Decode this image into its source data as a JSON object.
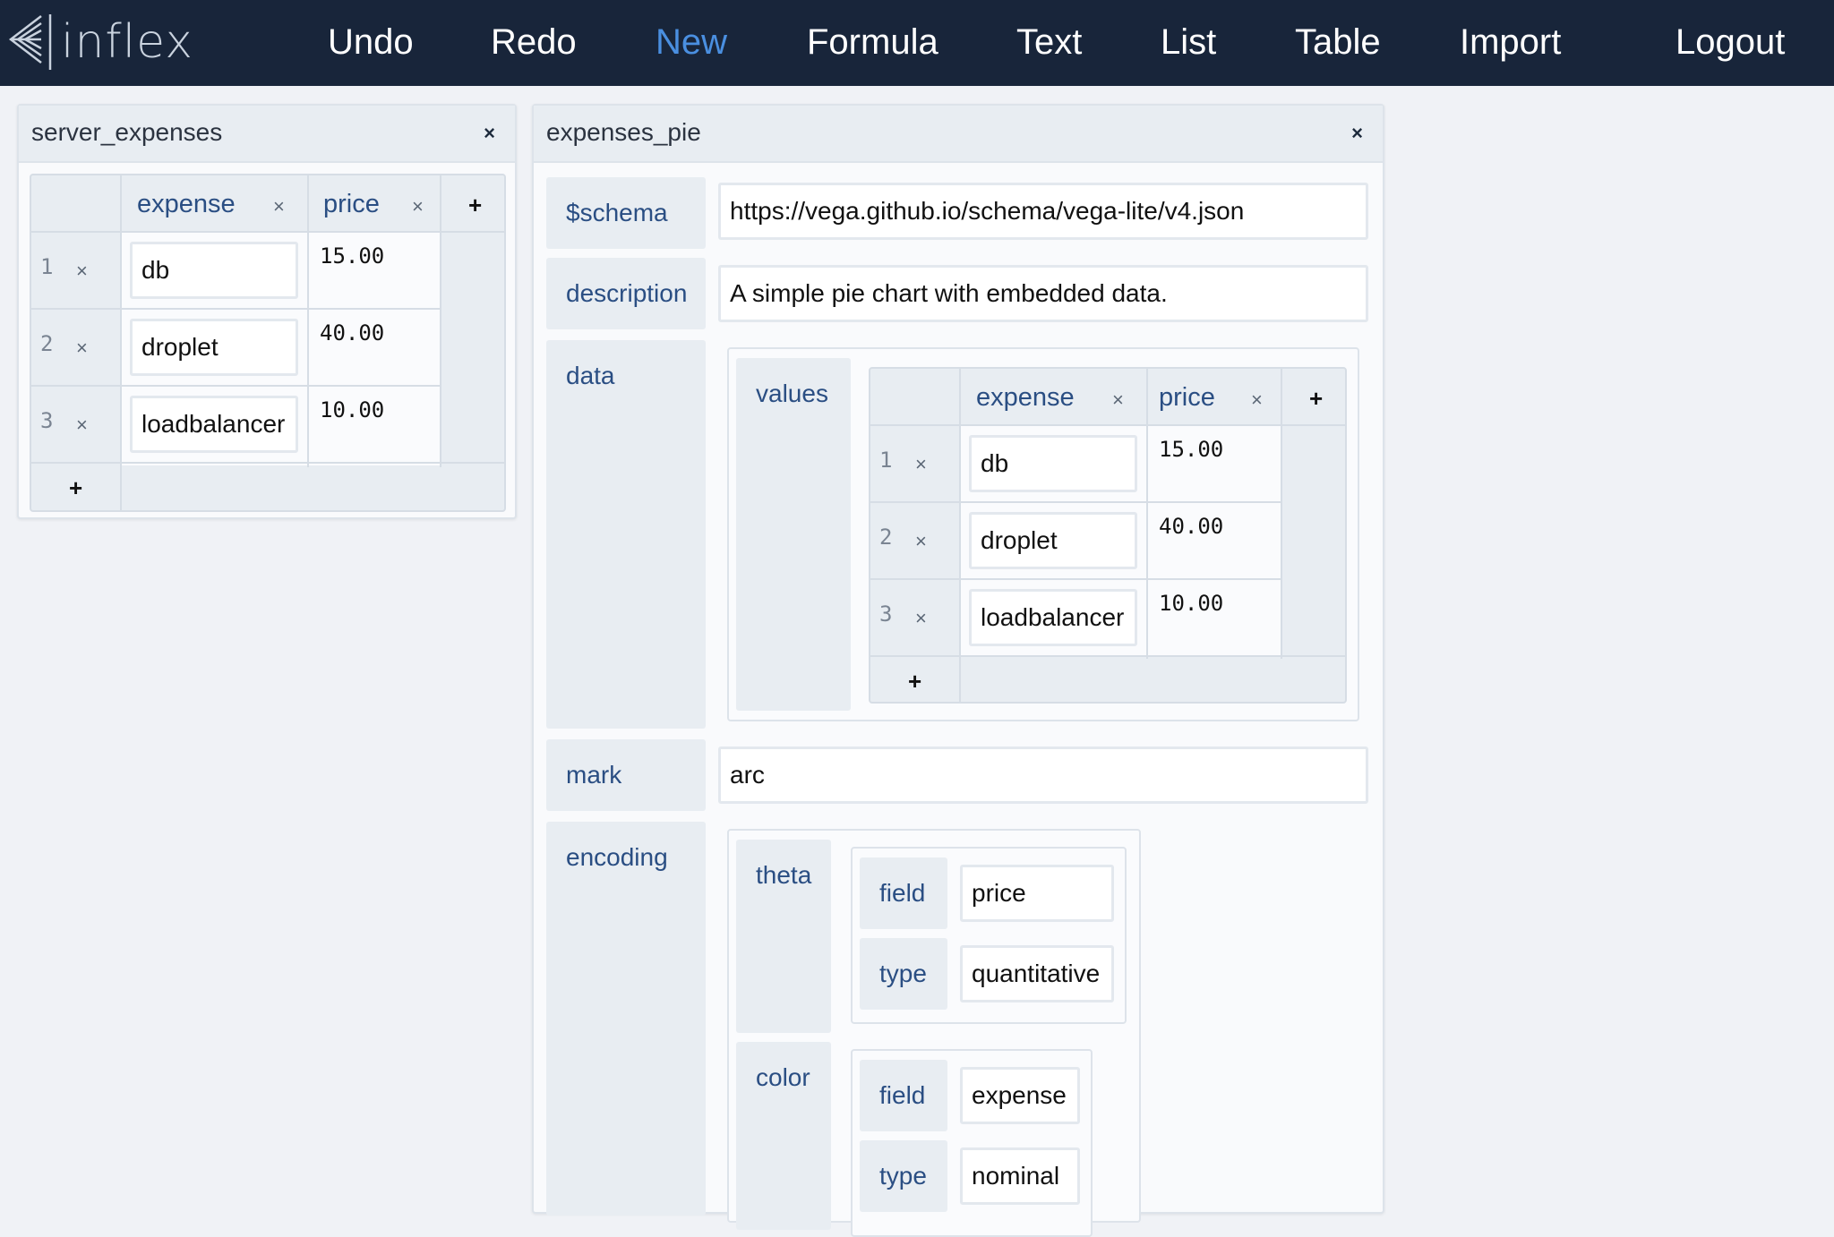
{
  "app": {
    "logo_text": "inflex"
  },
  "nav": {
    "undo": "Undo",
    "redo": "Redo",
    "new": "New",
    "formula": "Formula",
    "text": "Text",
    "list": "List",
    "table": "Table",
    "import": "Import",
    "logout": "Logout"
  },
  "colors": {
    "nav_bg": "#18253a",
    "active_nav": "#4a8fe0",
    "key_text": "#2a4e83"
  },
  "server_expenses": {
    "title": "server_expenses",
    "close": "×",
    "columns": [
      {
        "name": "expense",
        "remove": "×"
      },
      {
        "name": "price",
        "remove": "×"
      }
    ],
    "add_column": "+",
    "add_row": "+",
    "rows": [
      {
        "num": "1",
        "remove": "×",
        "expense": "db",
        "price": "15.00"
      },
      {
        "num": "2",
        "remove": "×",
        "expense": "droplet",
        "price": "40.00"
      },
      {
        "num": "3",
        "remove": "×",
        "expense": "loadbalancer",
        "price": "10.00"
      }
    ]
  },
  "expenses_pie": {
    "title": "expenses_pie",
    "close": "×",
    "fields": {
      "schema": {
        "key": "$schema",
        "value": "https://vega.github.io/schema/vega-lite/v4.json"
      },
      "description": {
        "key": "description",
        "value": "A simple pie chart with embedded data."
      },
      "data": {
        "key": "data",
        "values": {
          "key": "values",
          "columns": [
            {
              "name": "expense",
              "remove": "×"
            },
            {
              "name": "price",
              "remove": "×"
            }
          ],
          "add_column": "+",
          "add_row": "+",
          "rows": [
            {
              "num": "1",
              "remove": "×",
              "expense": "db",
              "price": "15.00"
            },
            {
              "num": "2",
              "remove": "×",
              "expense": "droplet",
              "price": "40.00"
            },
            {
              "num": "3",
              "remove": "×",
              "expense": "loadbalancer",
              "price": "10.00"
            }
          ]
        }
      },
      "mark": {
        "key": "mark",
        "value": "arc"
      },
      "encoding": {
        "key": "encoding",
        "theta": {
          "key": "theta",
          "field": {
            "key": "field",
            "value": "price"
          },
          "type": {
            "key": "type",
            "value": "quantitative"
          }
        },
        "color": {
          "key": "color",
          "field": {
            "key": "field",
            "value": "expense"
          },
          "type": {
            "key": "type",
            "value": "nominal"
          }
        }
      }
    }
  }
}
